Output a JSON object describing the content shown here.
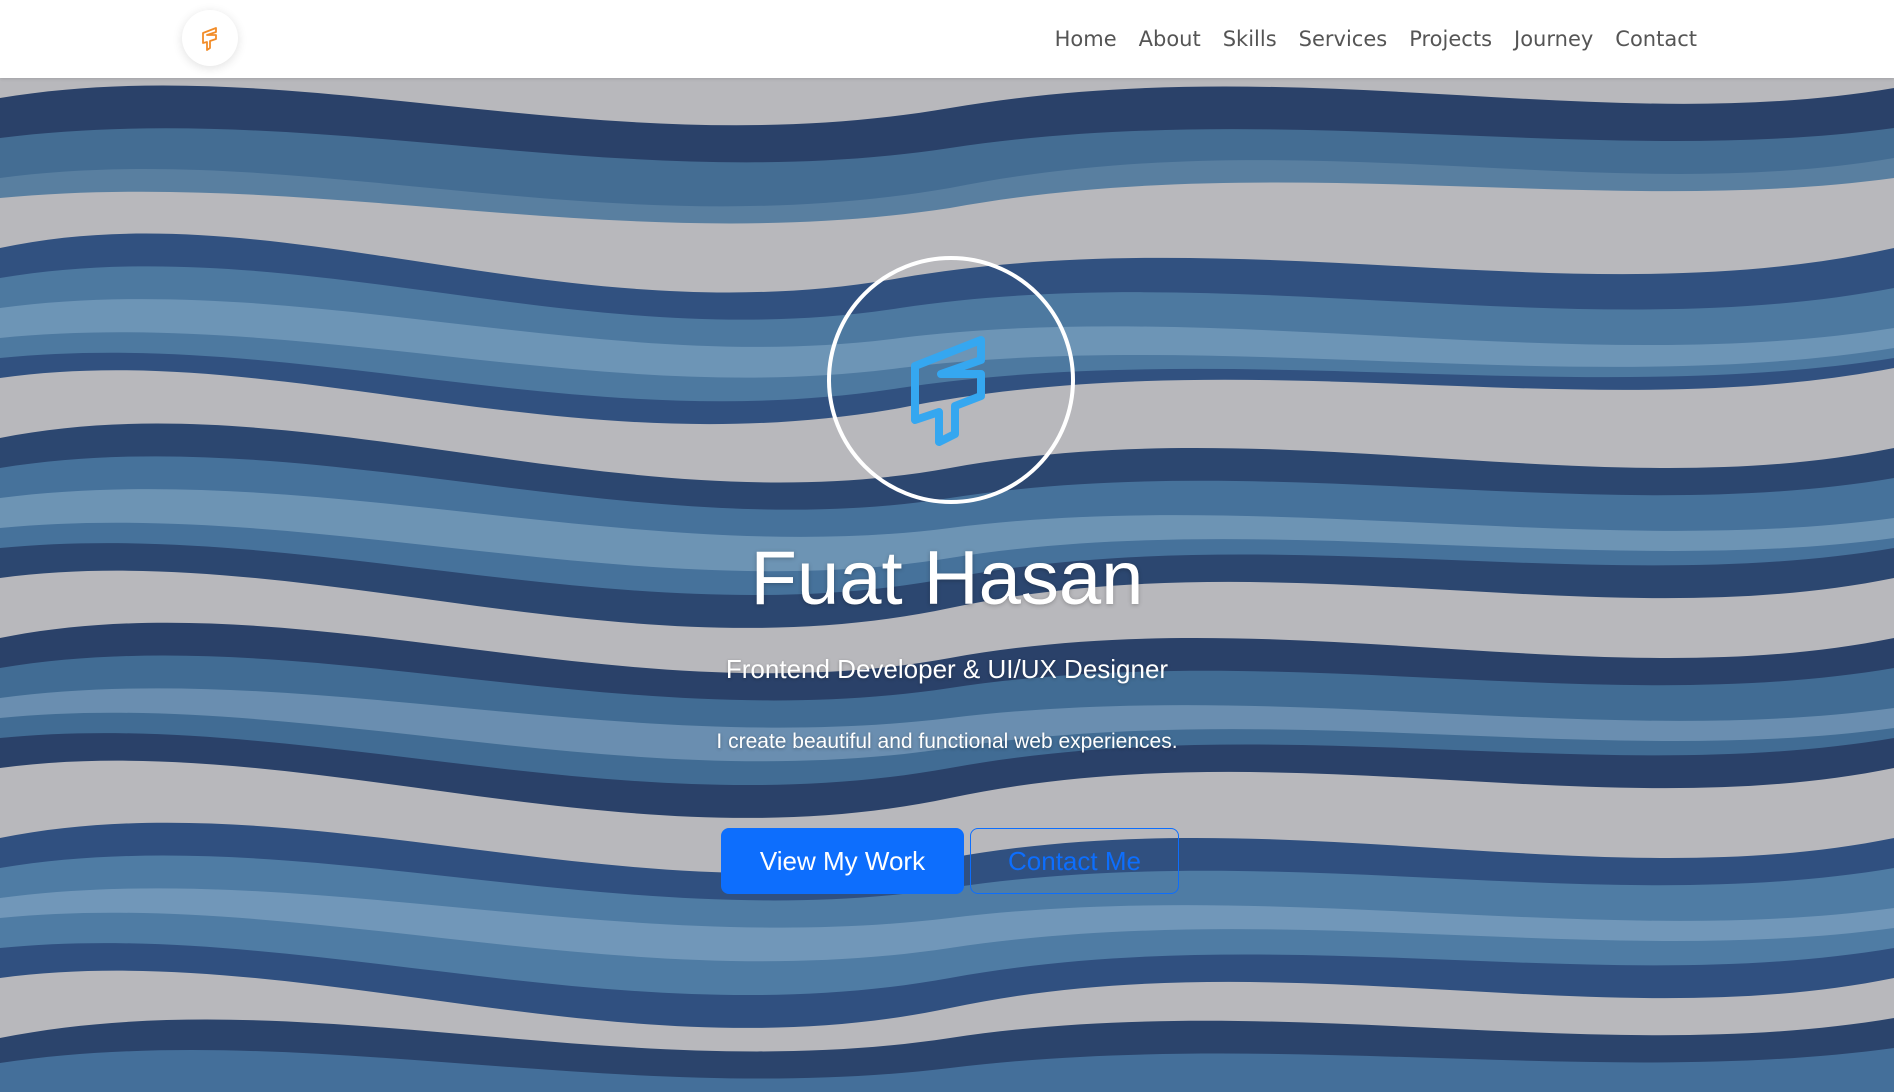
{
  "nav": {
    "brand_icon": "logo-icon",
    "links": [
      "Home",
      "About",
      "Skills",
      "Services",
      "Projects",
      "Journey",
      "Contact"
    ]
  },
  "hero": {
    "name": "Fuat Hasan",
    "subtitle": "Frontend Developer & UI/UX Designer",
    "tagline": "I create beautiful and functional web experiences.",
    "primary_button": "View My Work",
    "secondary_button": "Contact Me",
    "avatar_icon": "logo-icon"
  },
  "colors": {
    "accent": "#0d6efd",
    "brand_orange": "#f28c28",
    "logo_blue": "#35a7f0",
    "wave_dark": "#1b3560",
    "wave_mid": "#2f5f8c",
    "wave_light": "#6b98bb",
    "background_gray": "#b9b9bd"
  }
}
